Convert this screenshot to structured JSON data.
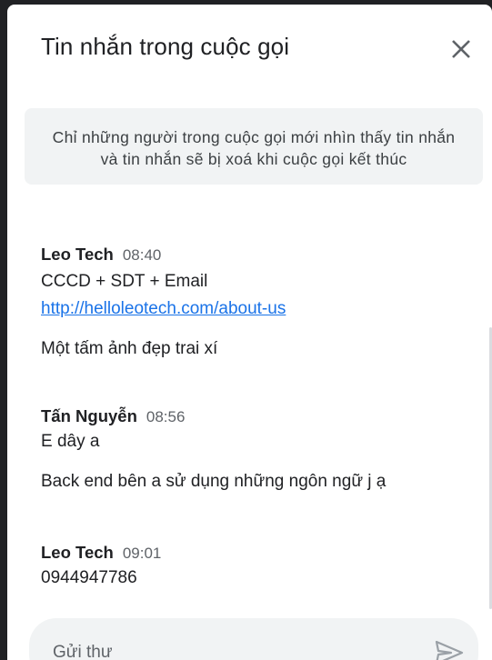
{
  "header": {
    "title": "Tin nhắn trong cuộc gọi",
    "close_icon": "close-icon"
  },
  "notice": {
    "line1": "Chỉ những người trong cuộc gọi mới nhìn thấy tin nhắn",
    "line2": "và tin nhắn sẽ bị xoá khi cuộc gọi kết thúc"
  },
  "messages": [
    {
      "sender": "Leo Tech",
      "time": "08:40",
      "lines": [
        "CCCD + SDT + Email"
      ],
      "link": "http://helloleotech.com/about-us",
      "extra": "Một tấm ảnh đẹp trai xí"
    },
    {
      "sender": "Tấn Nguyễn",
      "time": "08:56",
      "lines": [
        "E dây a"
      ],
      "extra": "Back end bên a sử dụng những ngôn ngữ j ạ"
    },
    {
      "sender": "Leo Tech",
      "time": "09:01",
      "lines": [
        "0944947786"
      ]
    }
  ],
  "compose": {
    "placeholder": "Gửi thư",
    "value": "",
    "send_icon": "send-icon"
  },
  "colors": {
    "link": "#1a73e8",
    "notice_bg": "#f1f3f4",
    "panel_bg": "#ffffff",
    "backdrop": "#202124"
  }
}
